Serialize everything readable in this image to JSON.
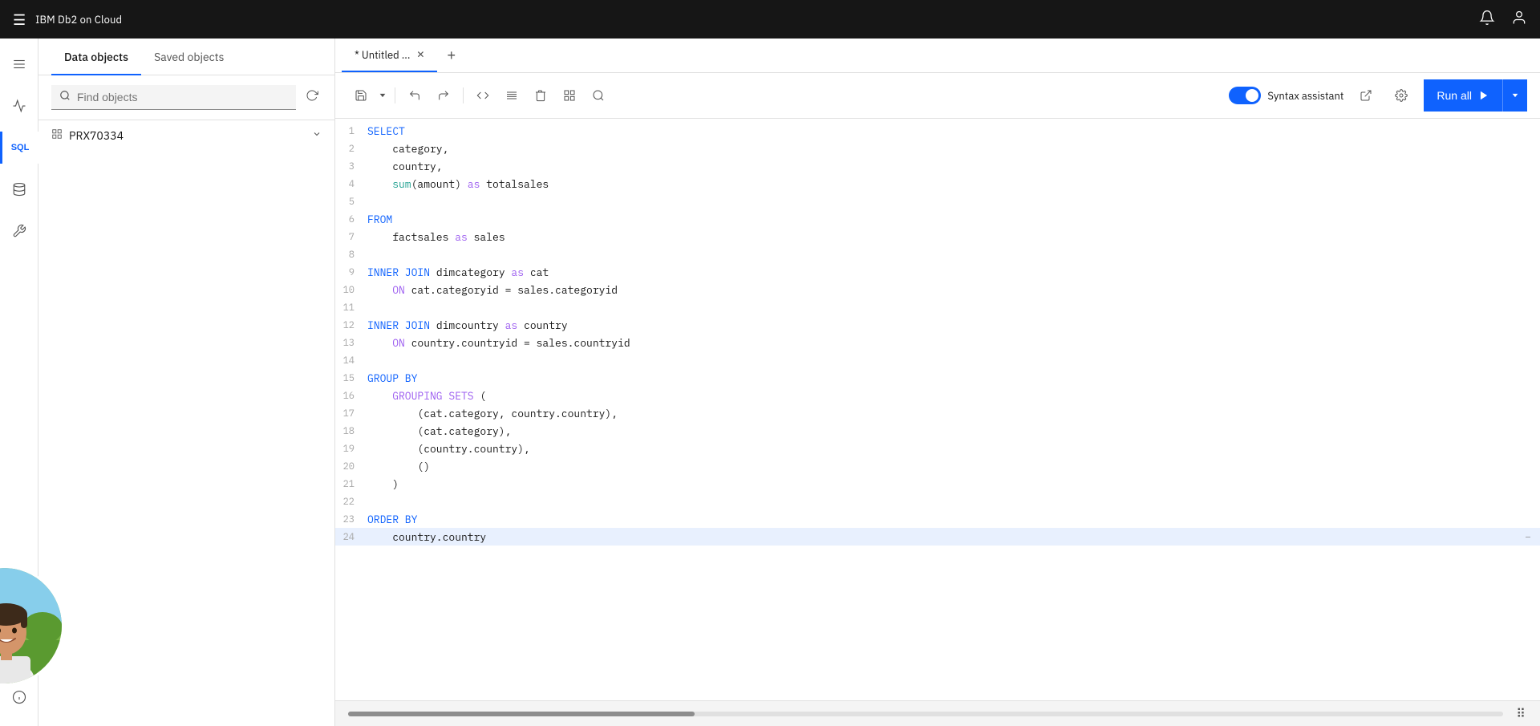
{
  "topbar": {
    "logo": "IBM Db2 on Cloud",
    "notification_icon": "🔔",
    "user_icon": "👤"
  },
  "sidebar": {
    "icons": [
      {
        "id": "menu",
        "symbol": "☰",
        "active": false
      },
      {
        "id": "chart",
        "symbol": "📈",
        "active": false
      },
      {
        "id": "sql",
        "label": "SQL",
        "active": true
      },
      {
        "id": "data",
        "symbol": "⬡",
        "active": false
      },
      {
        "id": "wrench",
        "symbol": "🔧",
        "active": false
      }
    ],
    "hint_icon": "💡"
  },
  "panel": {
    "tabs": [
      {
        "id": "data-objects",
        "label": "Data objects",
        "active": true
      },
      {
        "id": "saved-objects",
        "label": "Saved objects",
        "active": false
      }
    ],
    "search_placeholder": "Find objects",
    "tree_items": [
      {
        "id": "prx70334",
        "icon": "⊞",
        "label": "PRX70334",
        "expandable": true
      }
    ]
  },
  "editor": {
    "tabs": [
      {
        "id": "untitled",
        "label": "* Untitled ...",
        "active": true,
        "closeable": true
      }
    ],
    "add_tab_label": "+",
    "toolbar": {
      "buttons": [
        {
          "id": "save",
          "symbol": "💾"
        },
        {
          "id": "dropdown",
          "symbol": "▾"
        },
        {
          "id": "undo",
          "symbol": "↩"
        },
        {
          "id": "redo",
          "symbol": "↪"
        },
        {
          "id": "code",
          "symbol": "<>"
        },
        {
          "id": "format",
          "symbol": "¶"
        },
        {
          "id": "delete",
          "symbol": "🗑"
        },
        {
          "id": "split",
          "symbol": "⊞"
        },
        {
          "id": "search2",
          "symbol": "🔍"
        }
      ],
      "syntax_assistant_label": "Syntax assistant",
      "syntax_toggle_on": true,
      "export_icon": "⎋",
      "settings_icon": "⚙",
      "run_all_label": "Run all",
      "run_icon": "▶"
    },
    "code_lines": [
      {
        "num": 1,
        "code": "SELECT",
        "tokens": [
          {
            "text": "SELECT",
            "class": "kw"
          }
        ]
      },
      {
        "num": 2,
        "code": "    category,",
        "tokens": [
          {
            "text": "    category,",
            "class": ""
          }
        ]
      },
      {
        "num": 3,
        "code": "    country,",
        "tokens": [
          {
            "text": "    country,",
            "class": ""
          }
        ]
      },
      {
        "num": 4,
        "code": "    sum(amount) as totalsales",
        "tokens": [
          {
            "text": "    ",
            "class": ""
          },
          {
            "text": "sum",
            "class": "fn"
          },
          {
            "text": "(amount) as totalsales",
            "class": ""
          }
        ]
      },
      {
        "num": 5,
        "code": "",
        "tokens": []
      },
      {
        "num": 6,
        "code": "FROM",
        "tokens": [
          {
            "text": "FROM",
            "class": "kw"
          }
        ]
      },
      {
        "num": 7,
        "code": "    factsales as sales",
        "tokens": [
          {
            "text": "    factsales ",
            "class": ""
          },
          {
            "text": "as",
            "class": "kw2"
          },
          {
            "text": " sales",
            "class": ""
          }
        ]
      },
      {
        "num": 8,
        "code": "",
        "tokens": []
      },
      {
        "num": 9,
        "code": "INNER JOIN dimcategory as cat",
        "tokens": [
          {
            "text": "INNER JOIN",
            "class": "kw"
          },
          {
            "text": " dimcategory ",
            "class": ""
          },
          {
            "text": "as",
            "class": "kw2"
          },
          {
            "text": " cat",
            "class": ""
          }
        ]
      },
      {
        "num": 10,
        "code": "    ON cat.categoryid = sales.categoryid",
        "tokens": [
          {
            "text": "    ON",
            "class": "kw2"
          },
          {
            "text": " cat.categoryid = sales.categoryid",
            "class": ""
          }
        ]
      },
      {
        "num": 11,
        "code": "",
        "tokens": []
      },
      {
        "num": 12,
        "code": "INNER JOIN dimcountry as country",
        "tokens": [
          {
            "text": "INNER JOIN",
            "class": "kw"
          },
          {
            "text": " dimcountry ",
            "class": ""
          },
          {
            "text": "as",
            "class": "kw2"
          },
          {
            "text": " country",
            "class": ""
          }
        ]
      },
      {
        "num": 13,
        "code": "    ON country.countryid = sales.countryid",
        "tokens": [
          {
            "text": "    ON",
            "class": "kw2"
          },
          {
            "text": " country.countryid = sales.countryid",
            "class": ""
          }
        ]
      },
      {
        "num": 14,
        "code": "",
        "tokens": []
      },
      {
        "num": 15,
        "code": "GROUP BY",
        "tokens": [
          {
            "text": "GROUP BY",
            "class": "kw"
          }
        ]
      },
      {
        "num": 16,
        "code": "    GROUPING SETS (",
        "tokens": [
          {
            "text": "    GROUPING SETS",
            "class": "kw2"
          },
          {
            "text": " (",
            "class": ""
          }
        ]
      },
      {
        "num": 17,
        "code": "        (cat.category, country.country),",
        "tokens": [
          {
            "text": "        (cat.category, country.country),",
            "class": ""
          }
        ]
      },
      {
        "num": 18,
        "code": "        (cat.category),",
        "tokens": [
          {
            "text": "        (cat.category),",
            "class": ""
          }
        ]
      },
      {
        "num": 19,
        "code": "        (country.country),",
        "tokens": [
          {
            "text": "        (country.country),",
            "class": ""
          }
        ]
      },
      {
        "num": 20,
        "code": "        ()",
        "tokens": [
          {
            "text": "        ()",
            "class": ""
          }
        ]
      },
      {
        "num": 21,
        "code": "    )",
        "tokens": [
          {
            "text": "    )",
            "class": ""
          }
        ]
      },
      {
        "num": 22,
        "code": "",
        "tokens": []
      },
      {
        "num": 23,
        "code": "ORDER BY",
        "tokens": [
          {
            "text": "ORDER BY",
            "class": "kw"
          }
        ]
      },
      {
        "num": 24,
        "code": "    country.country",
        "tokens": [
          {
            "text": "    country.country",
            "class": ""
          }
        ],
        "highlighted": true
      }
    ]
  },
  "colors": {
    "brand_blue": "#0f62fe",
    "topbar_bg": "#161616",
    "border": "#e0e0e0"
  }
}
